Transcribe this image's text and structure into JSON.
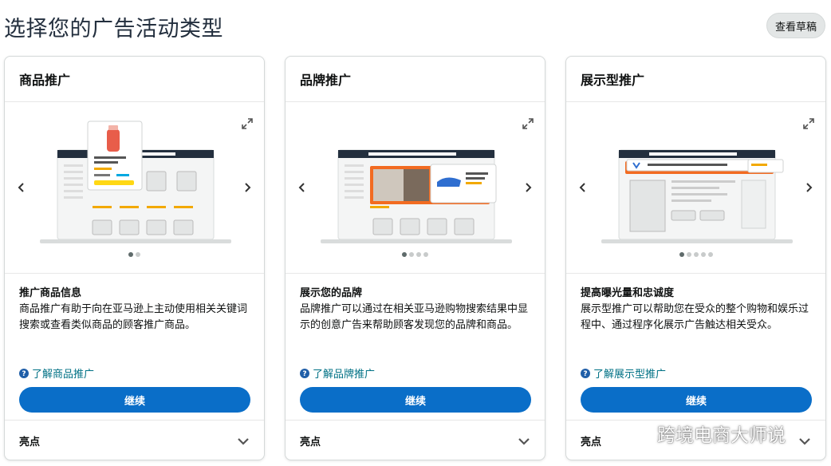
{
  "page": {
    "title": "选择您的广告活动类型",
    "drafts_label": "查看草稿"
  },
  "cards": [
    {
      "title": "商品推广",
      "subtitle": "推广商品信息",
      "description": "商品推广有助于向在亚马逊上主动使用相关关键词搜索或查看类似商品的顾客推广商品。",
      "learn_more": "了解商品推广",
      "cta": "继续",
      "footer": "亮点",
      "dots_total": 2,
      "dots_active": 0
    },
    {
      "title": "品牌推广",
      "subtitle": "展示您的品牌",
      "description": "品牌推广可以通过在相关亚马逊购物搜索结果中显示的创意广告来帮助顾客发现您的品牌和商品。",
      "learn_more": "了解品牌推广",
      "cta": "继续",
      "footer": "亮点",
      "dots_total": 4,
      "dots_active": 0
    },
    {
      "title": "展示型推广",
      "subtitle": "提高曝光量和忠诚度",
      "description": "展示型推广可以帮助您在受众的整个购物和娱乐过程中、通过程序化展示广告触达相关受众。",
      "learn_more": "了解展示型推广",
      "cta": "继续",
      "footer": "亮点",
      "dots_total": 5,
      "dots_active": 0
    }
  ],
  "watermark": {
    "text": "跨境电商大师说"
  },
  "colors": {
    "primary_button": "#0a6ec8",
    "link": "#007185",
    "accent_orange": "#f26b21"
  }
}
